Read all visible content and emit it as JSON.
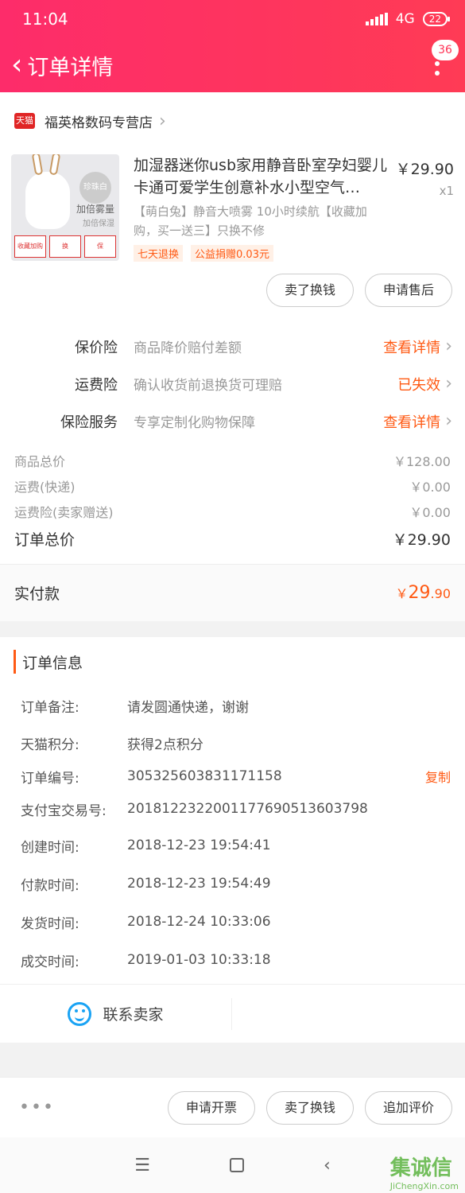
{
  "status": {
    "time": "11:04",
    "network": "4G",
    "battery": "22"
  },
  "nav": {
    "title": "订单详情",
    "badge": "36"
  },
  "shop": {
    "logo": "天猫",
    "name": "福英格数码专营店"
  },
  "product": {
    "name": "加湿器迷你usb家用静音卧室孕妇婴儿卡通可爱学生创意补水小型空气…",
    "desc": "【萌白兔】静音大喷雾 10小时续航【收藏加购，买一送三】只换不修",
    "tags": [
      "七天退换",
      "公益捐赠0.03元"
    ],
    "price": "￥29.90",
    "qty": "x1",
    "thumb": {
      "badge": "珍珠白",
      "line1": "加倍雾量",
      "line2": "加倍保湿",
      "strip": [
        "收藏加购",
        "换",
        "保"
      ]
    }
  },
  "product_buttons": [
    "卖了换钱",
    "申请售后"
  ],
  "insurance": [
    {
      "label": "保价险",
      "desc": "商品降价赔付差额",
      "link": "查看详情"
    },
    {
      "label": "运费险",
      "desc": "确认收货前退换货可理赔",
      "link": "已失效"
    },
    {
      "label": "保险服务",
      "desc": "专享定制化购物保障",
      "link": "查看详情"
    }
  ],
  "fees": [
    {
      "label": "商品总价",
      "value": "￥128.00"
    },
    {
      "label": "运费(快递)",
      "value": "￥0.00"
    },
    {
      "label": "运费险(卖家赠送)",
      "value": "￥0.00"
    }
  ],
  "order_total": {
    "label": "订单总价",
    "value": "￥29.90"
  },
  "paid": {
    "label": "实付款",
    "currency": "￥",
    "int": "29",
    "dec": ".90"
  },
  "info": {
    "title": "订单信息",
    "rows": [
      {
        "k": "订单备注:",
        "v": "请发圆通快递，谢谢"
      },
      {
        "k": "天猫积分:",
        "v": "获得2点积分"
      },
      {
        "k": "订单编号:",
        "v": "305325603831171158"
      },
      {
        "k": "支付宝交易号:",
        "v": "2018122322001177690513603798"
      },
      {
        "k": "创建时间:",
        "v": "2018-12-23 19:54:41"
      },
      {
        "k": "付款时间:",
        "v": "2018-12-23 19:54:49"
      },
      {
        "k": "发货时间:",
        "v": "2018-12-24 10:33:06"
      },
      {
        "k": "成交时间:",
        "v": "2019-01-03 10:33:18"
      }
    ],
    "copy": "复制"
  },
  "contact": {
    "label": "联系卖家"
  },
  "footer": {
    "dots": "•••",
    "buttons": [
      "申请开票",
      "卖了换钱",
      "追加评价"
    ]
  },
  "sysnav": {
    "menu": "☰",
    "back": "‹"
  },
  "watermark": {
    "main": "集诚信",
    "sub": "JiChengXin.com"
  }
}
